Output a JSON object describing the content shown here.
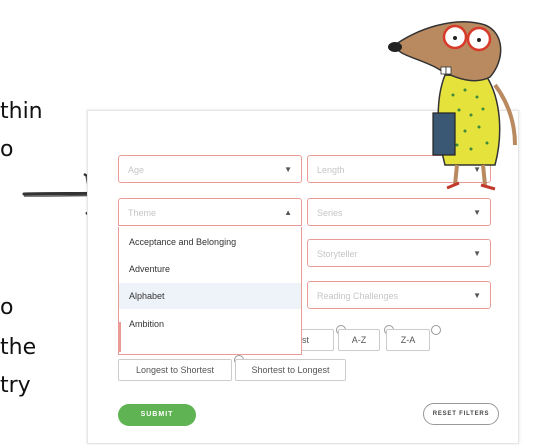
{
  "slide_text": {
    "line1": "thin",
    "line2": "o",
    "line3": "o",
    "line4": "the",
    "line5": "try"
  },
  "filters": {
    "age_placeholder": "Age",
    "length_placeholder": "Length",
    "theme_placeholder": "Theme",
    "series_placeholder": "Series",
    "storyteller_placeholder": "Storyteller",
    "reading_challenges_placeholder": "Reading Challenges"
  },
  "theme_options": [
    "Acceptance and Belonging",
    "Adventure",
    "Alphabet",
    "Ambition"
  ],
  "sort": {
    "shortest_partial": "est",
    "az": "A-Z",
    "za": "Z-A",
    "longest_to_shortest": "Longest to Shortest",
    "shortest_to_longest": "Shortest to Longest"
  },
  "actions": {
    "submit": "SUBMIT",
    "reset": "RESET FILTERS"
  },
  "colors": {
    "accent_border": "#e99d96",
    "submit_green": "#5fb352"
  },
  "icons": [
    "arrow-right-icon",
    "chevron-down-icon",
    "chevron-up-icon",
    "mole-illustration"
  ]
}
